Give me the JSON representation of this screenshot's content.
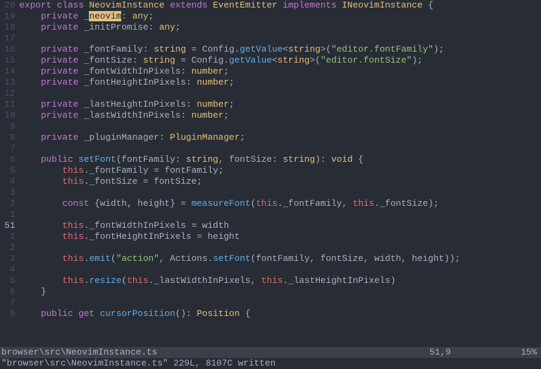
{
  "lines": [
    {
      "num": "20",
      "current": false,
      "tokens": [
        [
          "kw-export",
          "export"
        ],
        [
          "",
          ""
        ],
        [
          "kw-class",
          " class "
        ],
        [
          "classname",
          "NeovimInstance"
        ],
        [
          "",
          ""
        ],
        [
          "kw-extends",
          " extends "
        ],
        [
          "classname",
          "EventEmitter"
        ],
        [
          "kw-implements",
          " implements "
        ],
        [
          "classname",
          "INeovimInstance"
        ],
        [
          "punct",
          " {"
        ]
      ]
    },
    {
      "num": "19",
      "current": false,
      "tokens": [
        [
          "",
          "    "
        ],
        [
          "kw-private",
          "private"
        ],
        [
          "ident",
          " _"
        ],
        [
          "cursor-hl",
          "neovim"
        ],
        [
          "punct",
          ": "
        ],
        [
          "any",
          "any"
        ],
        [
          "punct",
          ";"
        ]
      ]
    },
    {
      "num": "18",
      "current": false,
      "tokens": [
        [
          "",
          "    "
        ],
        [
          "kw-private",
          "private"
        ],
        [
          "ident",
          " _initPromise"
        ],
        [
          "punct",
          ": "
        ],
        [
          "any",
          "any"
        ],
        [
          "punct",
          ";"
        ]
      ]
    },
    {
      "num": "17",
      "current": false,
      "tokens": []
    },
    {
      "num": "16",
      "current": false,
      "tokens": [
        [
          "",
          "    "
        ],
        [
          "kw-private",
          "private"
        ],
        [
          "ident",
          " _fontFamily"
        ],
        [
          "punct",
          ": "
        ],
        [
          "type",
          "string"
        ],
        [
          "op",
          " = "
        ],
        [
          "ident",
          "Config"
        ],
        [
          "punct",
          "."
        ],
        [
          "func",
          "getValue"
        ],
        [
          "generic",
          "<"
        ],
        [
          "type",
          "string"
        ],
        [
          "generic",
          ">"
        ],
        [
          "punct",
          "("
        ],
        [
          "string",
          "\"editor.fontFamily\""
        ],
        [
          "punct",
          ");"
        ]
      ]
    },
    {
      "num": "15",
      "current": false,
      "tokens": [
        [
          "",
          "    "
        ],
        [
          "kw-private",
          "private"
        ],
        [
          "ident",
          " _fontSize"
        ],
        [
          "punct",
          ": "
        ],
        [
          "type",
          "string"
        ],
        [
          "op",
          " = "
        ],
        [
          "ident",
          "Config"
        ],
        [
          "punct",
          "."
        ],
        [
          "func",
          "getValue"
        ],
        [
          "generic",
          "<"
        ],
        [
          "type",
          "string"
        ],
        [
          "generic",
          ">"
        ],
        [
          "punct",
          "("
        ],
        [
          "string",
          "\"editor.fontSize\""
        ],
        [
          "punct",
          ");"
        ]
      ]
    },
    {
      "num": "14",
      "current": false,
      "tokens": [
        [
          "",
          "    "
        ],
        [
          "kw-private",
          "private"
        ],
        [
          "ident",
          " _fontWidthInPixels"
        ],
        [
          "punct",
          ": "
        ],
        [
          "type",
          "number"
        ],
        [
          "punct",
          ";"
        ]
      ]
    },
    {
      "num": "13",
      "current": false,
      "tokens": [
        [
          "",
          "    "
        ],
        [
          "kw-private",
          "private"
        ],
        [
          "ident",
          " _fontHeightInPixels"
        ],
        [
          "punct",
          ": "
        ],
        [
          "type",
          "number"
        ],
        [
          "punct",
          ";"
        ]
      ]
    },
    {
      "num": "12",
      "current": false,
      "tokens": []
    },
    {
      "num": "11",
      "current": false,
      "tokens": [
        [
          "",
          "    "
        ],
        [
          "kw-private",
          "private"
        ],
        [
          "ident",
          " _lastHeightInPixels"
        ],
        [
          "punct",
          ": "
        ],
        [
          "type",
          "number"
        ],
        [
          "punct",
          ";"
        ]
      ]
    },
    {
      "num": "10",
      "current": false,
      "tokens": [
        [
          "",
          "    "
        ],
        [
          "kw-private",
          "private"
        ],
        [
          "ident",
          " _lastWidthInPixels"
        ],
        [
          "punct",
          ": "
        ],
        [
          "type",
          "number"
        ],
        [
          "punct",
          ";"
        ]
      ]
    },
    {
      "num": "9",
      "current": false,
      "tokens": []
    },
    {
      "num": "8",
      "current": false,
      "tokens": [
        [
          "",
          "    "
        ],
        [
          "kw-private",
          "private"
        ],
        [
          "ident",
          " _pluginManager"
        ],
        [
          "punct",
          ": "
        ],
        [
          "classname",
          "PluginManager"
        ],
        [
          "punct",
          ";"
        ]
      ]
    },
    {
      "num": "7",
      "current": false,
      "tokens": []
    },
    {
      "num": "6",
      "current": false,
      "tokens": [
        [
          "",
          "    "
        ],
        [
          "kw-public",
          "public"
        ],
        [
          "",
          ""
        ],
        [
          "func",
          " setFont"
        ],
        [
          "punct",
          "("
        ],
        [
          "ident",
          "fontFamily"
        ],
        [
          "punct",
          ": "
        ],
        [
          "type",
          "string"
        ],
        [
          "punct",
          ", "
        ],
        [
          "ident",
          "fontSize"
        ],
        [
          "punct",
          ": "
        ],
        [
          "type",
          "string"
        ],
        [
          "punct",
          "): "
        ],
        [
          "void",
          "void"
        ],
        [
          "punct",
          " {"
        ]
      ]
    },
    {
      "num": "5",
      "current": false,
      "tokens": [
        [
          "",
          "        "
        ],
        [
          "kw-this",
          "this"
        ],
        [
          "punct",
          "."
        ],
        [
          "ident",
          "_fontFamily"
        ],
        [
          "op",
          " = "
        ],
        [
          "ident",
          "fontFamily"
        ],
        [
          "punct",
          ";"
        ]
      ]
    },
    {
      "num": "4",
      "current": false,
      "tokens": [
        [
          "",
          "        "
        ],
        [
          "kw-this",
          "this"
        ],
        [
          "punct",
          "."
        ],
        [
          "ident",
          "_fontSize"
        ],
        [
          "op",
          " = "
        ],
        [
          "ident",
          "fontSize"
        ],
        [
          "punct",
          ";"
        ]
      ]
    },
    {
      "num": "3",
      "current": false,
      "tokens": []
    },
    {
      "num": "2",
      "current": false,
      "tokens": [
        [
          "",
          "        "
        ],
        [
          "kw-const",
          "const"
        ],
        [
          "punct",
          " {"
        ],
        [
          "ident",
          "width"
        ],
        [
          "punct",
          ", "
        ],
        [
          "ident",
          "height"
        ],
        [
          "punct",
          "} "
        ],
        [
          "op",
          "= "
        ],
        [
          "func",
          "measureFont"
        ],
        [
          "punct",
          "("
        ],
        [
          "kw-this",
          "this"
        ],
        [
          "punct",
          "."
        ],
        [
          "ident",
          "_fontFamily"
        ],
        [
          "punct",
          ", "
        ],
        [
          "kw-this",
          "this"
        ],
        [
          "punct",
          "."
        ],
        [
          "ident",
          "_fontSize"
        ],
        [
          "punct",
          ");"
        ]
      ]
    },
    {
      "num": "1",
      "current": false,
      "tokens": []
    },
    {
      "num": "51",
      "current": true,
      "tokens": [
        [
          "",
          "        "
        ],
        [
          "kw-this",
          "this"
        ],
        [
          "punct",
          "."
        ],
        [
          "ident",
          "_fontWidthInPixels"
        ],
        [
          "op",
          " = "
        ],
        [
          "ident",
          "width"
        ]
      ]
    },
    {
      "num": "1",
      "current": false,
      "tokens": [
        [
          "",
          "        "
        ],
        [
          "kw-this",
          "this"
        ],
        [
          "punct",
          "."
        ],
        [
          "ident",
          "_fontHeightInPixels"
        ],
        [
          "op",
          " = "
        ],
        [
          "ident",
          "height"
        ]
      ]
    },
    {
      "num": "2",
      "current": false,
      "tokens": []
    },
    {
      "num": "3",
      "current": false,
      "tokens": [
        [
          "",
          "        "
        ],
        [
          "kw-this",
          "this"
        ],
        [
          "punct",
          "."
        ],
        [
          "func",
          "emit"
        ],
        [
          "punct",
          "("
        ],
        [
          "string",
          "\"action\""
        ],
        [
          "punct",
          ", "
        ],
        [
          "ident",
          "Actions"
        ],
        [
          "punct",
          "."
        ],
        [
          "func",
          "setFont"
        ],
        [
          "punct",
          "("
        ],
        [
          "ident",
          "fontFamily"
        ],
        [
          "punct",
          ", "
        ],
        [
          "ident",
          "fontSize"
        ],
        [
          "punct",
          ", "
        ],
        [
          "ident",
          "width"
        ],
        [
          "punct",
          ", "
        ],
        [
          "ident",
          "height"
        ],
        [
          "punct",
          "));"
        ]
      ]
    },
    {
      "num": "4",
      "current": false,
      "tokens": []
    },
    {
      "num": "5",
      "current": false,
      "tokens": [
        [
          "",
          "        "
        ],
        [
          "kw-this",
          "this"
        ],
        [
          "punct",
          "."
        ],
        [
          "func",
          "resize"
        ],
        [
          "punct",
          "("
        ],
        [
          "kw-this",
          "this"
        ],
        [
          "punct",
          "."
        ],
        [
          "ident",
          "_lastWidthInPixels"
        ],
        [
          "punct",
          ", "
        ],
        [
          "kw-this",
          "this"
        ],
        [
          "punct",
          "."
        ],
        [
          "ident",
          "_lastHeightInPixels"
        ],
        [
          "punct",
          ")"
        ]
      ]
    },
    {
      "num": "6",
      "current": false,
      "tokens": [
        [
          "",
          "    "
        ],
        [
          "punct",
          "}"
        ]
      ]
    },
    {
      "num": "7",
      "current": false,
      "tokens": []
    },
    {
      "num": "8",
      "current": false,
      "tokens": [
        [
          "",
          "    "
        ],
        [
          "kw-public",
          "public"
        ],
        [
          "",
          ""
        ],
        [
          "kw-get",
          " get "
        ],
        [
          "func",
          "cursorPosition"
        ],
        [
          "punct",
          "(): "
        ],
        [
          "classname",
          "Position"
        ],
        [
          "punct",
          " {"
        ]
      ]
    }
  ],
  "status": {
    "file": "browser\\src\\NeovimInstance.ts",
    "pos": "51,9",
    "pct": "15%"
  },
  "cmdline": "\"browser\\src\\NeovimInstance.ts\" 229L, 8107C written"
}
